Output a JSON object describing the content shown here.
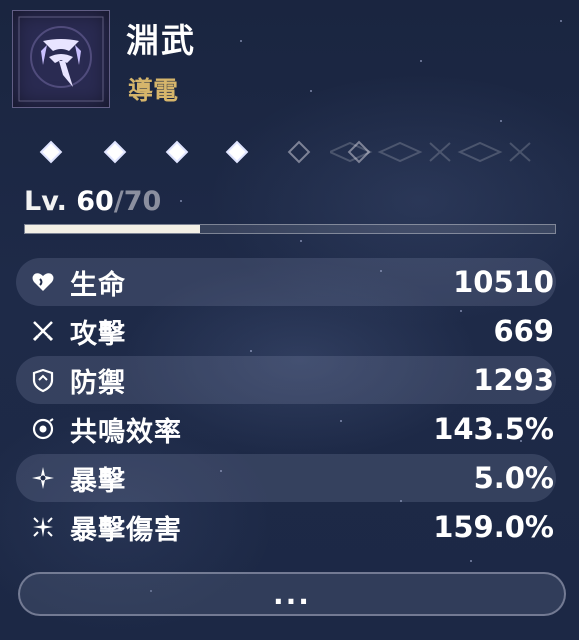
{
  "character": {
    "name": "淵武",
    "element": "導電",
    "icon": "weapon-emblem-icon",
    "accent_color": "#d6b56b"
  },
  "sequence": {
    "nodes": [
      {
        "unlocked": true
      },
      {
        "unlocked": true
      },
      {
        "unlocked": true
      },
      {
        "unlocked": true
      },
      {
        "unlocked": false
      },
      {
        "unlocked": false
      }
    ]
  },
  "level": {
    "prefix": "Lv. ",
    "current": "60",
    "separator": "/",
    "max": "70",
    "progress_fraction": 0.33
  },
  "stats": [
    {
      "icon": "heart-icon",
      "label": "生命",
      "value": "10510"
    },
    {
      "icon": "sword-icon",
      "label": "攻擊",
      "value": "669"
    },
    {
      "icon": "shield-icon",
      "label": "防禦",
      "value": "1293"
    },
    {
      "icon": "energy-regen-icon",
      "label": "共鳴效率",
      "value": "143.5%"
    },
    {
      "icon": "crit-rate-icon",
      "label": "暴擊",
      "value": "5.0%"
    },
    {
      "icon": "crit-damage-icon",
      "label": "暴擊傷害",
      "value": "159.0%"
    }
  ],
  "more_button": {
    "label": "..."
  }
}
